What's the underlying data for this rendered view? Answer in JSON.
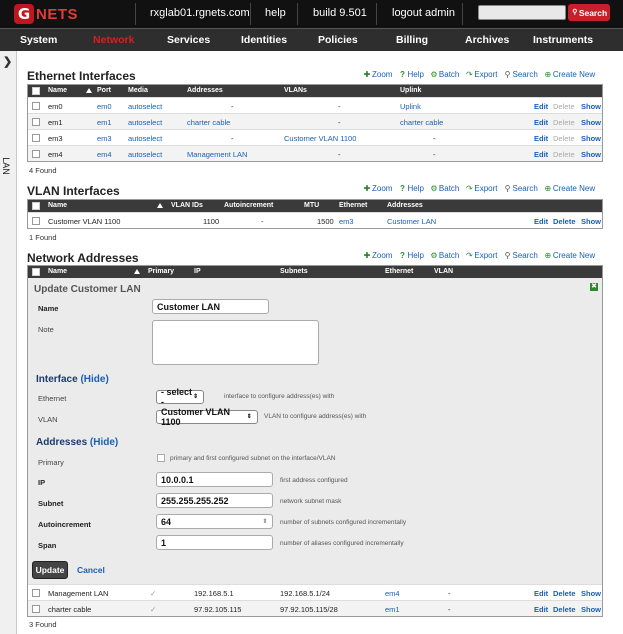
{
  "topbar": {
    "logo_letter": "G",
    "logo_text": "NETS",
    "host": "rxglab01.rgnets.com",
    "help": "help",
    "build": "build 9.501",
    "logout": "logout admin",
    "search_placeholder": "",
    "search_button": "Search"
  },
  "nav": {
    "items": [
      "System",
      "Network",
      "Services",
      "Identities",
      "Policies",
      "Billing",
      "Archives",
      "Instruments"
    ],
    "active": "Network"
  },
  "sidebar": {
    "label": "LAN"
  },
  "toolbar": {
    "zoom": "Zoom",
    "help": "Help",
    "batch": "Batch",
    "export": "Export",
    "search": "Search",
    "create": "Create New"
  },
  "ethernet": {
    "title": "Ethernet Interfaces",
    "headers": [
      "Name",
      "Port",
      "Media",
      "Addresses",
      "VLANs",
      "Uplink"
    ],
    "rows": [
      {
        "name": "em0",
        "port": "em0",
        "media": "autoselect",
        "addresses": "-",
        "vlans": "-",
        "uplink": "Uplink",
        "delete_enabled": false
      },
      {
        "name": "em1",
        "port": "em1",
        "media": "autoselect",
        "addresses": "charter cable",
        "vlans": "-",
        "uplink": "charter cable",
        "delete_enabled": false
      },
      {
        "name": "em3",
        "port": "em3",
        "media": "autoselect",
        "addresses": "-",
        "vlans": "Customer VLAN 1100",
        "uplink": "-",
        "delete_enabled": false
      },
      {
        "name": "em4",
        "port": "em4",
        "media": "autoselect",
        "addresses": "Management LAN",
        "vlans": "-",
        "uplink": "-",
        "delete_enabled": false
      }
    ],
    "found": "4 Found"
  },
  "vlan": {
    "title": "VLAN Interfaces",
    "headers": [
      "Name",
      "VLAN IDs",
      "Autoincrement",
      "MTU",
      "Ethernet",
      "Addresses"
    ],
    "rows": [
      {
        "name": "Customer VLAN 1100",
        "ids": "1100",
        "auto": "-",
        "mtu": "1500",
        "ethernet": "em3",
        "addresses": "Customer LAN"
      }
    ],
    "found": "1 Found"
  },
  "network": {
    "title": "Network Addresses",
    "headers": [
      "Name",
      "Primary",
      "IP",
      "Subnets",
      "Ethernet",
      "VLAN"
    ],
    "rows": [
      {
        "name": "Management LAN",
        "ip": "192.168.5.1",
        "subnet": "192.168.5.1/24",
        "ethernet": "em4",
        "vlan": "-"
      },
      {
        "name": "charter cable",
        "ip": "97.92.105.115",
        "subnet": "97.92.105.115/28",
        "ethernet": "em1",
        "vlan": "-"
      }
    ],
    "found": "3 Found"
  },
  "row_actions": {
    "edit": "Edit",
    "delete": "Delete",
    "show": "Show"
  },
  "form": {
    "title": "Update Customer LAN",
    "name_label": "Name",
    "name_value": "Customer LAN",
    "note_label": "Note",
    "interface_heading": "Interface",
    "hide": "(Hide)",
    "ethernet_label": "Ethernet",
    "ethernet_value": "- select -",
    "ethernet_hint": "interface to configure address(es) with",
    "vlan_label": "VLAN",
    "vlan_value": "Customer VLAN 1100",
    "vlan_hint": "VLAN to configure address(es) with",
    "addresses_heading": "Addresses",
    "primary_label": "Primary",
    "primary_hint": "primary and first configured subnet on the interface/VLAN",
    "ip_label": "IP",
    "ip_value": "10.0.0.1",
    "ip_hint": "first address configured",
    "subnet_label": "Subnet",
    "subnet_value": "255.255.255.252",
    "subnet_hint": "network subnet mask",
    "auto_label": "Autoincrement",
    "auto_value": "64",
    "auto_hint": "number of subnets configured incrementally",
    "span_label": "Span",
    "span_value": "1",
    "span_hint": "number of aliases configured incrementally",
    "update_button": "Update",
    "cancel_button": "Cancel"
  },
  "colors": {
    "brand_red": "#c0161d",
    "link": "#1a5fb4",
    "header_dark": "#3a3a3a"
  }
}
